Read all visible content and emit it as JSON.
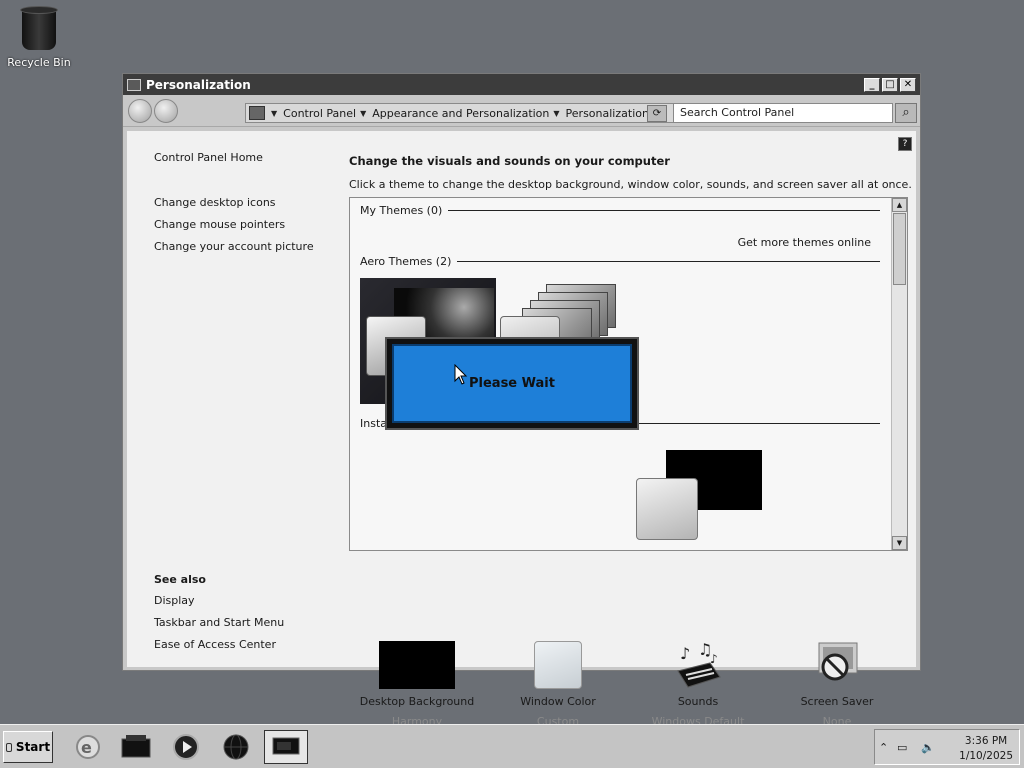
{
  "desktop": {
    "recycle_bin_label": "Recycle Bin"
  },
  "window": {
    "title": "Personalization",
    "buttons": {
      "minimize": "_",
      "maximize": "□",
      "close": "✕"
    }
  },
  "address": {
    "segments": [
      "Control Panel",
      "Appearance and Personalization",
      "Personalization"
    ],
    "search_placeholder": "Search Control Panel"
  },
  "sidebar": {
    "home": "Control Panel Home",
    "links": [
      "Change desktop icons",
      "Change mouse pointers",
      "Change your account picture"
    ],
    "see_also_title": "See also",
    "see_also": [
      "Display",
      "Taskbar and Start Menu",
      "Ease of Access Center"
    ]
  },
  "main": {
    "heading": "Change the visuals and sounds on your computer",
    "subheading": "Click a theme to change the desktop background, window color, sounds, and screen saver all at once.",
    "my_themes": "My Themes (0)",
    "get_more": "Get more themes online",
    "aero_themes": "Aero Themes (2)",
    "installed_partial": "Insta"
  },
  "dialog": {
    "message": "Please Wait"
  },
  "tiles": [
    {
      "label": "Desktop Background",
      "sub": "Harmony"
    },
    {
      "label": "Window Color",
      "sub": "Custom"
    },
    {
      "label": "Sounds",
      "sub": "Windows Default"
    },
    {
      "label": "Screen Saver",
      "sub": "None"
    }
  ],
  "taskbar": {
    "start_label": "Start",
    "time": "3:36 PM",
    "date": "1/10/2025"
  },
  "colors": {
    "dialog_blue": "#1e7fd8",
    "titlebar": "#3c3c3c",
    "desktop": "#6b6f75"
  }
}
